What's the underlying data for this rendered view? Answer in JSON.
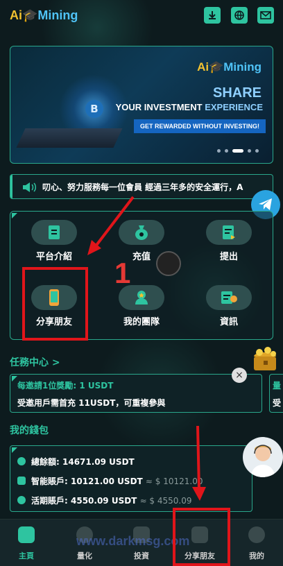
{
  "header": {
    "logo_ai": "Ai",
    "logo_mining": "Mining",
    "icons": [
      "download-icon",
      "globe-icon",
      "mail-icon"
    ]
  },
  "banner": {
    "logo_ai": "Ai",
    "logo_mining": "Mining",
    "headline": "SHARE",
    "tagline_a": "YOUR INVESTMENT",
    "tagline_b": "EXPERIENCE",
    "cta": "GET REWARDED WITHOUT INVESTING!",
    "btc_symbol": "B",
    "slides": 5,
    "active_slide": 3
  },
  "notice": {
    "text": "叨心、努力服務每一位會員 經過三年多的安全運行，A"
  },
  "menu": [
    {
      "label": "平台介紹",
      "icon": "document-icon"
    },
    {
      "label": "充值",
      "icon": "money-bag-icon"
    },
    {
      "label": "提出",
      "icon": "withdraw-icon"
    },
    {
      "label": "分享朋友",
      "icon": "phone-share-icon"
    },
    {
      "label": "我的團隊",
      "icon": "team-icon"
    },
    {
      "label": "資訊",
      "icon": "news-icon"
    }
  ],
  "annotation": {
    "number": "1"
  },
  "tasks": {
    "title": "任務中心 >",
    "card_title": "每邀請1位獎勵:  1 USDT",
    "card_desc": "受邀用戶需首充 11USDT，可重複參與",
    "close": "×",
    "peek_head": "量",
    "peek_desc": "受"
  },
  "wallet": {
    "title": "我的錢包",
    "rows": [
      {
        "label": "總餘額:",
        "value": "14671.09 USDT",
        "sub": ""
      },
      {
        "label": "智能賬戶:",
        "value": "10121.00 USDT",
        "sub": "≈ $ 10121.00"
      },
      {
        "label": "活期賬戶:",
        "value": "4550.09 USDT",
        "sub": "≈ $ 4550.09"
      }
    ]
  },
  "nav": [
    {
      "label": "主頁",
      "active": true
    },
    {
      "label": "量化",
      "active": false
    },
    {
      "label": "投資",
      "active": false
    },
    {
      "label": "分享朋友",
      "active": false
    },
    {
      "label": "我的",
      "active": false
    }
  ],
  "watermark": "www.darkmsg.com",
  "colors": {
    "accent": "#2ec4a0",
    "bg": "#0d1b1e",
    "logo_gold": "#f2c230",
    "annotation_red": "#e0151a"
  }
}
